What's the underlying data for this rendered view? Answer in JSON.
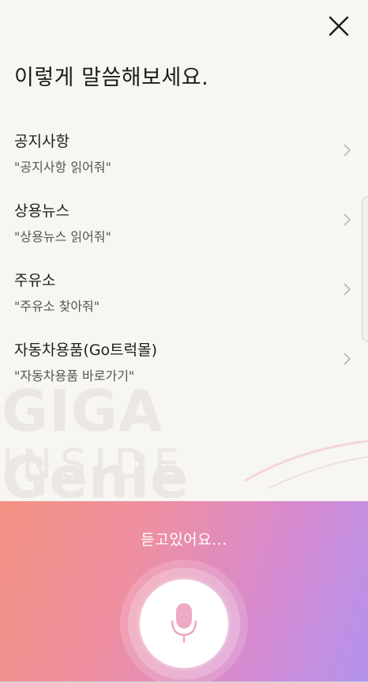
{
  "header": {
    "close_icon": "close-icon",
    "title": "이렇게 말씀해보세요."
  },
  "items": [
    {
      "title": "공지사항",
      "example": "\"공지사항 읽어줘\""
    },
    {
      "title": "상용뉴스",
      "example": "\"상용뉴스 읽어줘\""
    },
    {
      "title": "주유소",
      "example": "\"주유소 찾아줘\""
    },
    {
      "title": "자동차용품(Go트럭몰)",
      "example": "\"자동차용품 바로가기\""
    }
  ],
  "watermark": {
    "line1": "GIGA Genie",
    "line2": "INSIDE"
  },
  "voice_panel": {
    "status": "듣고있어요...",
    "mic_icon": "microphone-icon",
    "gradient_colors": [
      "#f39384",
      "#ef8fa0",
      "#d68ad0",
      "#b393ee"
    ],
    "mic_color": "#eeaac4"
  }
}
